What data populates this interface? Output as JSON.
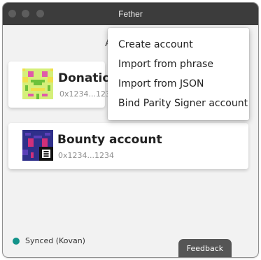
{
  "window": {
    "title": "Fether"
  },
  "header": {
    "peek_text": "A"
  },
  "accounts": [
    {
      "name": "Donation",
      "address": "0x1234...1234",
      "avatar": "pixel-identicon-yellow-green"
    },
    {
      "name": "Bounty account",
      "address": "0x1234...1234",
      "avatar": "pixel-identicon-navy-magenta"
    }
  ],
  "menu": {
    "items": [
      {
        "label": "Create account"
      },
      {
        "label": "Import from phrase"
      },
      {
        "label": "Import from JSON"
      },
      {
        "label": "Bind Parity Signer account"
      }
    ]
  },
  "status": {
    "label": "Synced (Kovan)",
    "color": "#13938a"
  },
  "feedback": {
    "label": "Feedback"
  },
  "colors": {
    "titlebar": "#3c3c3c",
    "background": "#f2f2f2",
    "card": "#ffffff",
    "feedback": "#555555"
  }
}
